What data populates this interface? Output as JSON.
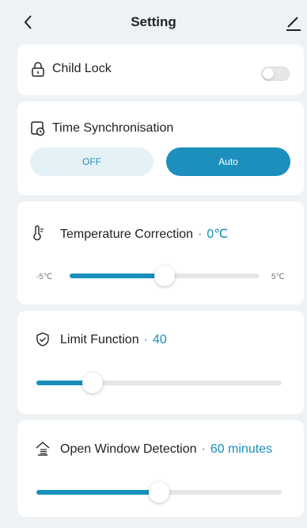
{
  "header": {
    "title": "Setting"
  },
  "child_lock": {
    "label": "Child Lock",
    "enabled": false
  },
  "time_sync": {
    "label": "Time Synchronisation",
    "options": [
      "OFF",
      "Auto"
    ],
    "selected": "Auto"
  },
  "temperature_correction": {
    "label": "Temperature Correction",
    "value": "0℃",
    "min_label": "-5℃",
    "max_label": "5℃",
    "min": -5,
    "max": 5,
    "current": 0
  },
  "limit_function": {
    "label": "Limit Function",
    "value": "40",
    "level_fraction": 0.23
  },
  "open_window": {
    "label": "Open Window Detection",
    "value": "60 minutes",
    "level_fraction": 0.5
  },
  "colors": {
    "accent": "#1a8fbc",
    "background": "#eef2f4",
    "track": "#e4e6e8"
  }
}
